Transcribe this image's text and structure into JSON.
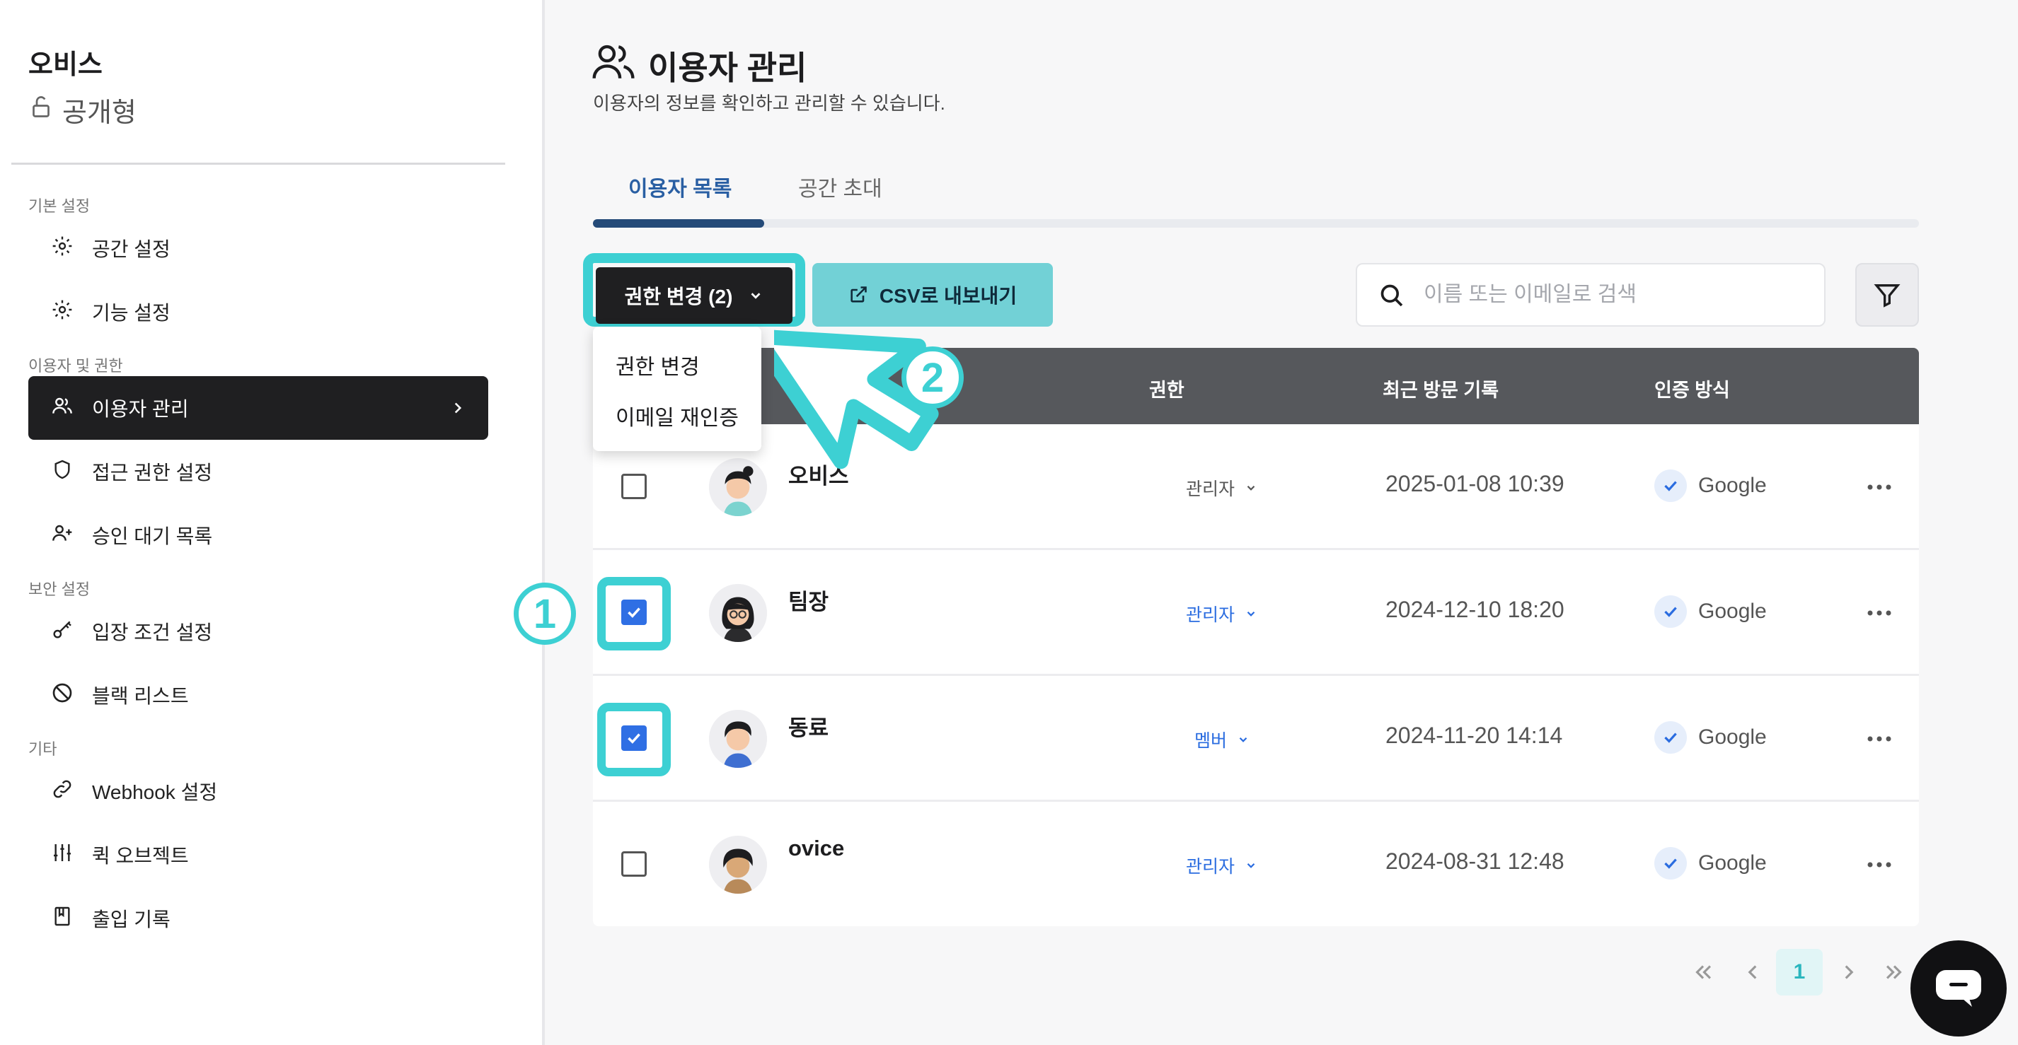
{
  "sidebar": {
    "org_name": "오비스",
    "org_type": "공개형",
    "sections": [
      {
        "label": "기본 설정"
      },
      {
        "label": "이용자 및 권한"
      },
      {
        "label": "보안 설정"
      },
      {
        "label": "기타"
      }
    ],
    "items": [
      {
        "label": "공간 설정",
        "icon": "gear-icon"
      },
      {
        "label": "기능 설정",
        "icon": "gear-icon"
      },
      {
        "label": "이용자 관리",
        "icon": "users-icon"
      },
      {
        "label": "접근 권한 설정",
        "icon": "shield-icon"
      },
      {
        "label": "승인 대기 목록",
        "icon": "user-add-icon"
      },
      {
        "label": "입장 조건 설정",
        "icon": "key-icon"
      },
      {
        "label": "블랙 리스트",
        "icon": "ban-icon"
      },
      {
        "label": "Webhook 설정",
        "icon": "link-icon"
      },
      {
        "label": "퀵 오브젝트",
        "icon": "sliders-icon"
      },
      {
        "label": "출입 기록",
        "icon": "book-icon"
      }
    ],
    "active_item": "이용자 관리"
  },
  "header": {
    "title": "이용자 관리",
    "subtitle": "이용자의 정보를 확인하고 관리할 수 있습니다."
  },
  "tabs": [
    {
      "label": "이용자 목록",
      "active": true
    },
    {
      "label": "공간 초대",
      "active": false
    }
  ],
  "toolbar": {
    "perm_change_label": "권한 변경 (2)",
    "csv_export_label": "CSV로 내보내기",
    "search_placeholder": "이름 또는 이메일로 검색"
  },
  "dropdown": {
    "items": [
      "권한 변경",
      "이메일 재인증"
    ]
  },
  "table": {
    "columns": [
      "권한",
      "최근 방문 기록",
      "인증 방식"
    ],
    "rows": [
      {
        "name": "오비스",
        "role": "관리자",
        "last_visit": "2025-01-08 10:39",
        "auth": "Google",
        "checked": false
      },
      {
        "name": "팀장",
        "role": "관리자",
        "last_visit": "2024-12-10 18:20",
        "auth": "Google",
        "checked": true
      },
      {
        "name": "동료",
        "role": "멤버",
        "last_visit": "2024-11-20 14:14",
        "auth": "Google",
        "checked": true
      },
      {
        "name": "ovice",
        "role": "관리자",
        "last_visit": "2024-08-31 12:48",
        "auth": "Google",
        "checked": false
      }
    ]
  },
  "pagination": {
    "current_page": "1"
  },
  "annotations": {
    "step1": "1",
    "step2": "2"
  },
  "colors": {
    "accent": "#3dd0d3",
    "primary_dark": "#1f1f21",
    "link_blue": "#2a6ce0",
    "tab_active": "#2a5fa3"
  }
}
